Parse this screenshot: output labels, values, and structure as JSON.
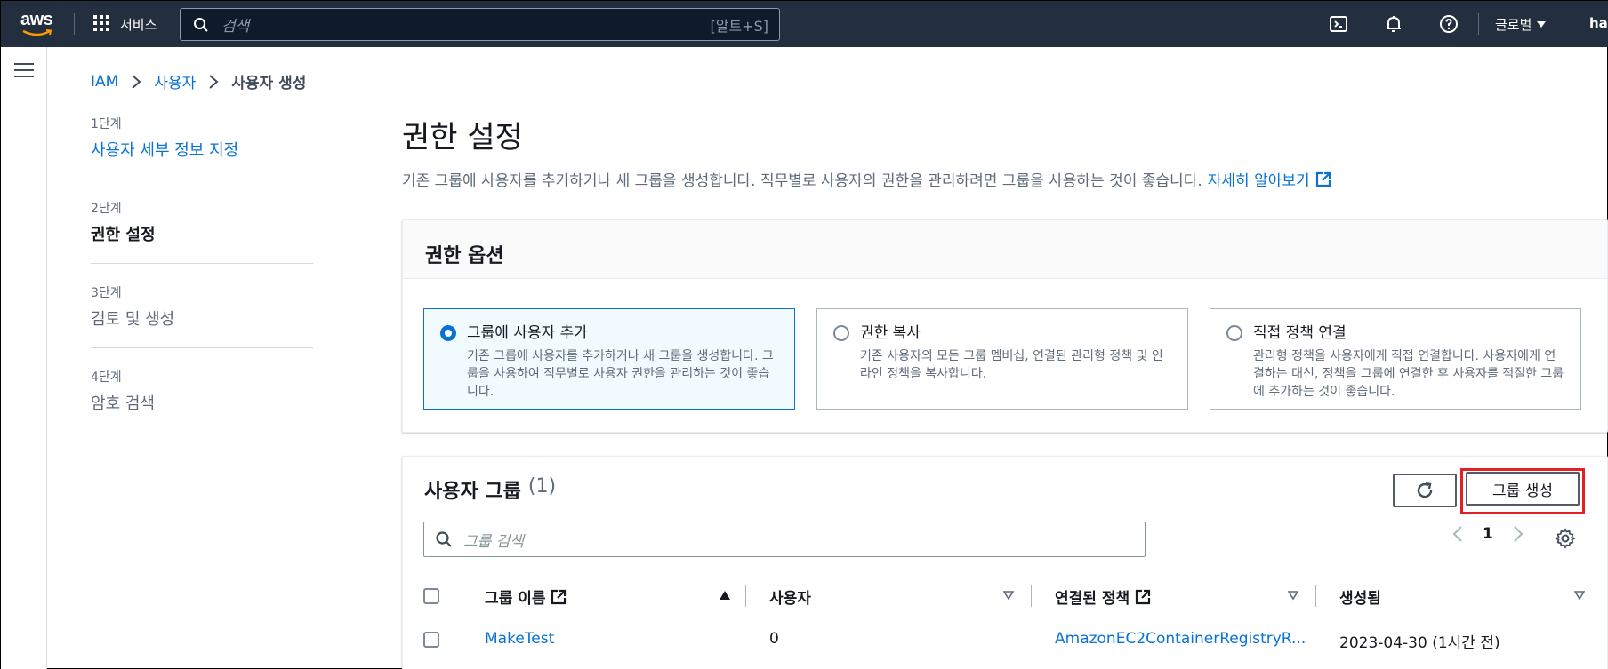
{
  "topnav": {
    "logo": "aws",
    "services_label": "서비스",
    "search_placeholder": "검색",
    "search_shortcut": "[알트+S]",
    "region_label": "글로벌",
    "user_label": "ha",
    "icons": [
      "cloudshell-icon",
      "bell-icon",
      "help-icon"
    ]
  },
  "breadcrumb": {
    "items": [
      "IAM",
      "사용자"
    ],
    "current": "사용자 생성"
  },
  "steps": [
    {
      "num": "1단계",
      "name": "사용자 세부 정보 지정",
      "state": "link"
    },
    {
      "num": "2단계",
      "name": "권한 설정",
      "state": "active"
    },
    {
      "num": "3단계",
      "name": "검토 및 생성",
      "state": "inactive"
    },
    {
      "num": "4단계",
      "name": "암호 검색",
      "state": "inactive"
    }
  ],
  "page": {
    "title": "권한 설정",
    "description": "기존 그룹에 사용자를 추가하거나 새 그룹을 생성합니다. 직무별로 사용자의 권한을 관리하려면 그룹을 사용하는 것이 좋습니다.",
    "learn_more": "자세히 알아보기"
  },
  "permission_options": {
    "title": "권한 옵션",
    "options": [
      {
        "title": "그룹에 사용자 추가",
        "text": "기존 그룹에 사용자를 추가하거나 새 그룹을 생성합니다. 그룹을 사용하여 직무별로 사용자 권한을 관리하는 것이 좋습니다.",
        "selected": true
      },
      {
        "title": "권한 복사",
        "text": "기존 사용자의 모든 그룹 멤버십, 연결된 관리형 정책 및 인라인 정책을 복사합니다.",
        "selected": false
      },
      {
        "title": "직접 정책 연결",
        "text": "관리형 정책을 사용자에게 직접 연결합니다. 사용자에게 연결하는 대신, 정책을 그룹에 연결한 후 사용자를 적절한 그룹에 추가하는 것이 좋습니다.",
        "selected": false
      }
    ]
  },
  "user_groups": {
    "title": "사용자 그룹",
    "count": "(1)",
    "create_button": "그룹 생성",
    "search_placeholder": "그룹 검색",
    "page": "1",
    "columns": [
      "그룹 이름",
      "사용자",
      "연결된 정책",
      "생성됨"
    ],
    "rows": [
      {
        "name": "MakeTest",
        "users": "0",
        "policies": "AmazonEC2ContainerRegistryR...",
        "created": "2023-04-30 (1시간 전)"
      }
    ]
  },
  "colors": {
    "nav_bg": "#232f3e",
    "link": "#0972d3",
    "highlight": "#e22025"
  }
}
